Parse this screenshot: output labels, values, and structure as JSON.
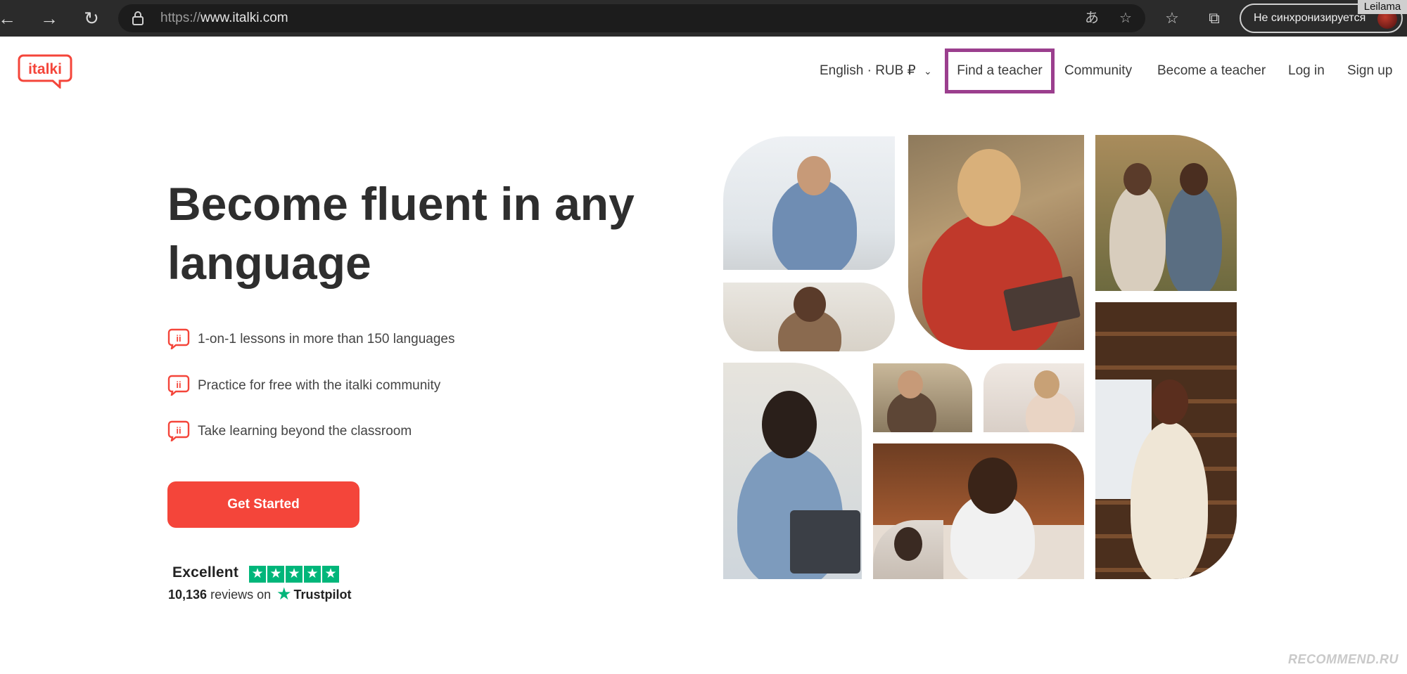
{
  "browser": {
    "url_scheme": "https://",
    "url_host": "www.italki.com",
    "sync_label": "Не синхронизируется",
    "user_name": "Leilama"
  },
  "header": {
    "logo_text": "italki",
    "currency_selector": "English · RUB ₽",
    "nav": {
      "find_teacher": "Find a teacher",
      "community": "Community",
      "become_teacher": "Become a teacher",
      "log_in": "Log in",
      "sign_up": "Sign up"
    }
  },
  "hero": {
    "title_line1": "Become fluent in any",
    "title_line2": "language",
    "features": [
      "1-on-1 lessons in more than 150 languages",
      "Practice for free with the italki community",
      "Take learning beyond the classroom"
    ],
    "cta_label": "Get Started"
  },
  "trustpilot": {
    "rating_label": "Excellent",
    "review_count": "10,136",
    "reviews_on": "reviews on",
    "brand": "Trustpilot",
    "stars": 5
  },
  "colors": {
    "brand_red": "#f4453a",
    "highlight_frame": "#9b3f8e",
    "trustpilot_green": "#00b67a"
  },
  "watermark": "RECOMMEND.RU"
}
